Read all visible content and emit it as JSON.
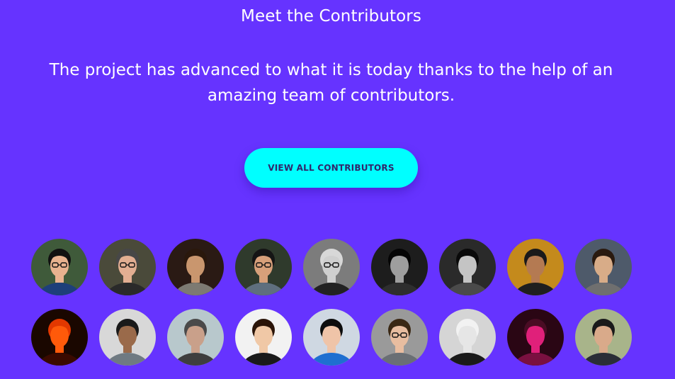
{
  "section": {
    "title": "Meet the Contributors",
    "description": "The project has advanced to what it is today thanks to the help of an amazing team of contributors.",
    "cta_label": "VIEW ALL CONTRIBUTORS"
  },
  "colors": {
    "background": "#6633ff",
    "cta_background": "#00ffff",
    "cta_text": "#31266a"
  },
  "contributors": [
    [
      {
        "bg": "#3f5a3a",
        "skin": "#e8b28f",
        "hair": "#111111",
        "shirt": "#1e3f7a",
        "glasses": true
      },
      {
        "bg": "#4a4a3a",
        "skin": "#e2ae92",
        "hair": "#474747",
        "shirt": "#2a2a2a",
        "glasses": true
      },
      {
        "bg": "#2a1a14",
        "skin": "#c9966e",
        "hair": "#2a180c",
        "shirt": "#7d7a72",
        "glasses": false
      },
      {
        "bg": "#2f3a2c",
        "skin": "#d7a07a",
        "hair": "#151515",
        "shirt": "#5f6f7e",
        "glasses": true
      },
      {
        "bg": "#7c7c7c",
        "skin": "#cfcfcf",
        "hair": "#d8d8d8",
        "shirt": "#222222",
        "glasses": true
      },
      {
        "bg": "#1d1d1d",
        "skin": "#9e9e9e",
        "hair": "#050505",
        "shirt": "#2e2e2e",
        "glasses": false
      },
      {
        "bg": "#2a2a2a",
        "skin": "#c4c4c4",
        "hair": "#0a0a0a",
        "shirt": "#4a4a4a",
        "glasses": false
      },
      {
        "bg": "#c48a1c",
        "skin": "#b47a52",
        "hair": "#1a1a1a",
        "shirt": "#1f1f1f",
        "glasses": false
      },
      {
        "bg": "#4e5a6a",
        "skin": "#d8ac88",
        "hair": "#2a1a10",
        "shirt": "#6f6f6f",
        "glasses": false
      }
    ],
    [
      {
        "bg": "#1a0700",
        "skin": "#ff5a0a",
        "hair": "#e23800",
        "shirt": "#3a0a00",
        "glasses": false
      },
      {
        "bg": "#d8d8d8",
        "skin": "#9a6a4a",
        "hair": "#1a1a1a",
        "shirt": "#6f7a82",
        "glasses": false
      },
      {
        "bg": "#b8c8cc",
        "skin": "#c9a08a",
        "hair": "#4a4a4a",
        "shirt": "#3e3e3e",
        "glasses": false
      },
      {
        "bg": "#f2f2f2",
        "skin": "#f0c8a6",
        "hair": "#2a1408",
        "shirt": "#1a1a1a",
        "glasses": false
      },
      {
        "bg": "#cfd8e2",
        "skin": "#efc4a8",
        "hair": "#0d0d0d",
        "shirt": "#1f6fd0",
        "glasses": false
      },
      {
        "bg": "#9a9a9a",
        "skin": "#e8bda0",
        "hair": "#3a2814",
        "shirt": "#6a6f74",
        "glasses": true
      },
      {
        "bg": "#d5d5d5",
        "skin": "#e6e6e6",
        "hair": "#f2f2f2",
        "shirt": "#1a1a1a",
        "glasses": false
      },
      {
        "bg": "#2a0614",
        "skin": "#e0207a",
        "hair": "#4a0c24",
        "shirt": "#7a1040",
        "glasses": false
      },
      {
        "bg": "#a8b48a",
        "skin": "#d9aa8a",
        "hair": "#1a1a1a",
        "shirt": "#2a2e36",
        "glasses": false
      }
    ]
  ]
}
